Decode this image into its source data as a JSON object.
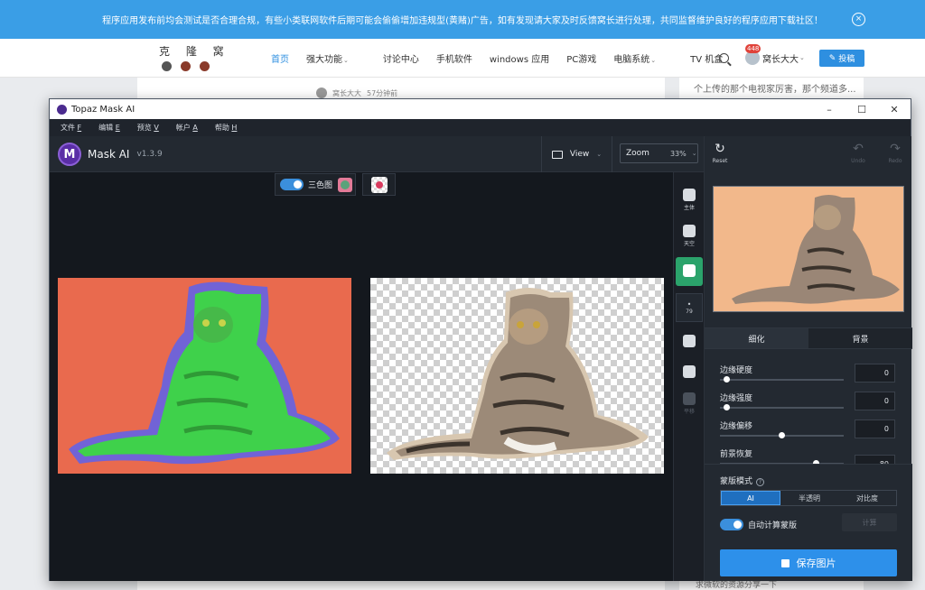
{
  "notice": {
    "text": "程序应用发布前均会测试是否合理合规，有些小类联网软件后期可能会偷偷增加违规型(黄赌)广告，如有发现请大家及时反馈窝长进行处理，共同监督维护良好的程序应用下载社区！",
    "close_icon": "⨯"
  },
  "site": {
    "logo_text": "克 隆 窝",
    "nav": [
      {
        "label": "首页",
        "active": true
      },
      {
        "label": "强大功能",
        "caret": true
      },
      {
        "label": "讨论中心"
      },
      {
        "label": "手机软件"
      },
      {
        "label": "windows 应用"
      },
      {
        "label": "PC游戏"
      },
      {
        "label": "电脑系统",
        "caret": true
      },
      {
        "label": "TV 机盒"
      }
    ],
    "user_name": "窝长大大",
    "badge": "448",
    "contribute": "投稿",
    "author": "窝长大大",
    "time": "57分钟前",
    "side_text": "个上传的那个电视家厉害，那个频道多...",
    "side_bottom": "求微软的资源分享一下"
  },
  "app": {
    "window_title": "Topaz Mask AI",
    "menus": [
      {
        "label": "文件",
        "key": "F"
      },
      {
        "label": "编辑",
        "key": "E"
      },
      {
        "label": "预览",
        "key": "V"
      },
      {
        "label": "帐户",
        "key": "A"
      },
      {
        "label": "帮助",
        "key": "H"
      }
    ],
    "brand_letter": "M",
    "brand_name": "Mask AI",
    "version": "v1.3.9",
    "view_label": "View",
    "zoom_label": "Zoom",
    "zoom_value": "33%",
    "tricolor_label": "三色图",
    "tools": [
      {
        "label": "主体",
        "icon": "subject-icon"
      },
      {
        "label": "天空",
        "icon": "sky-icon"
      },
      {
        "label": "",
        "icon": "brush-add-icon",
        "active": true
      }
    ],
    "brush_size": "79",
    "tools_lower": [
      {
        "label": "",
        "icon": "fill-bucket-icon"
      },
      {
        "label": "",
        "icon": "eyedropper-icon"
      },
      {
        "label": "平移",
        "icon": "hand-icon",
        "dim": true
      }
    ],
    "reset_label": "Reset",
    "undo_label": "Undo",
    "redo_label": "Redo",
    "tab_refine": "细化",
    "tab_background": "背景",
    "sliders": [
      {
        "label": "边缘硬度",
        "value": "0",
        "level": 0
      },
      {
        "label": "边缘强度",
        "value": "0",
        "level": 0
      },
      {
        "label": "边缘偏移",
        "value": "0",
        "level": 0.5
      },
      {
        "label": "前景恢复",
        "value": "80",
        "level": 0.8
      }
    ],
    "mask_mode_label": "蒙版模式",
    "modes": [
      "AI",
      "半透明",
      "对比度"
    ],
    "auto_label": "自动计算蒙版",
    "calc_label": "计算",
    "save_label": "保存图片"
  }
}
